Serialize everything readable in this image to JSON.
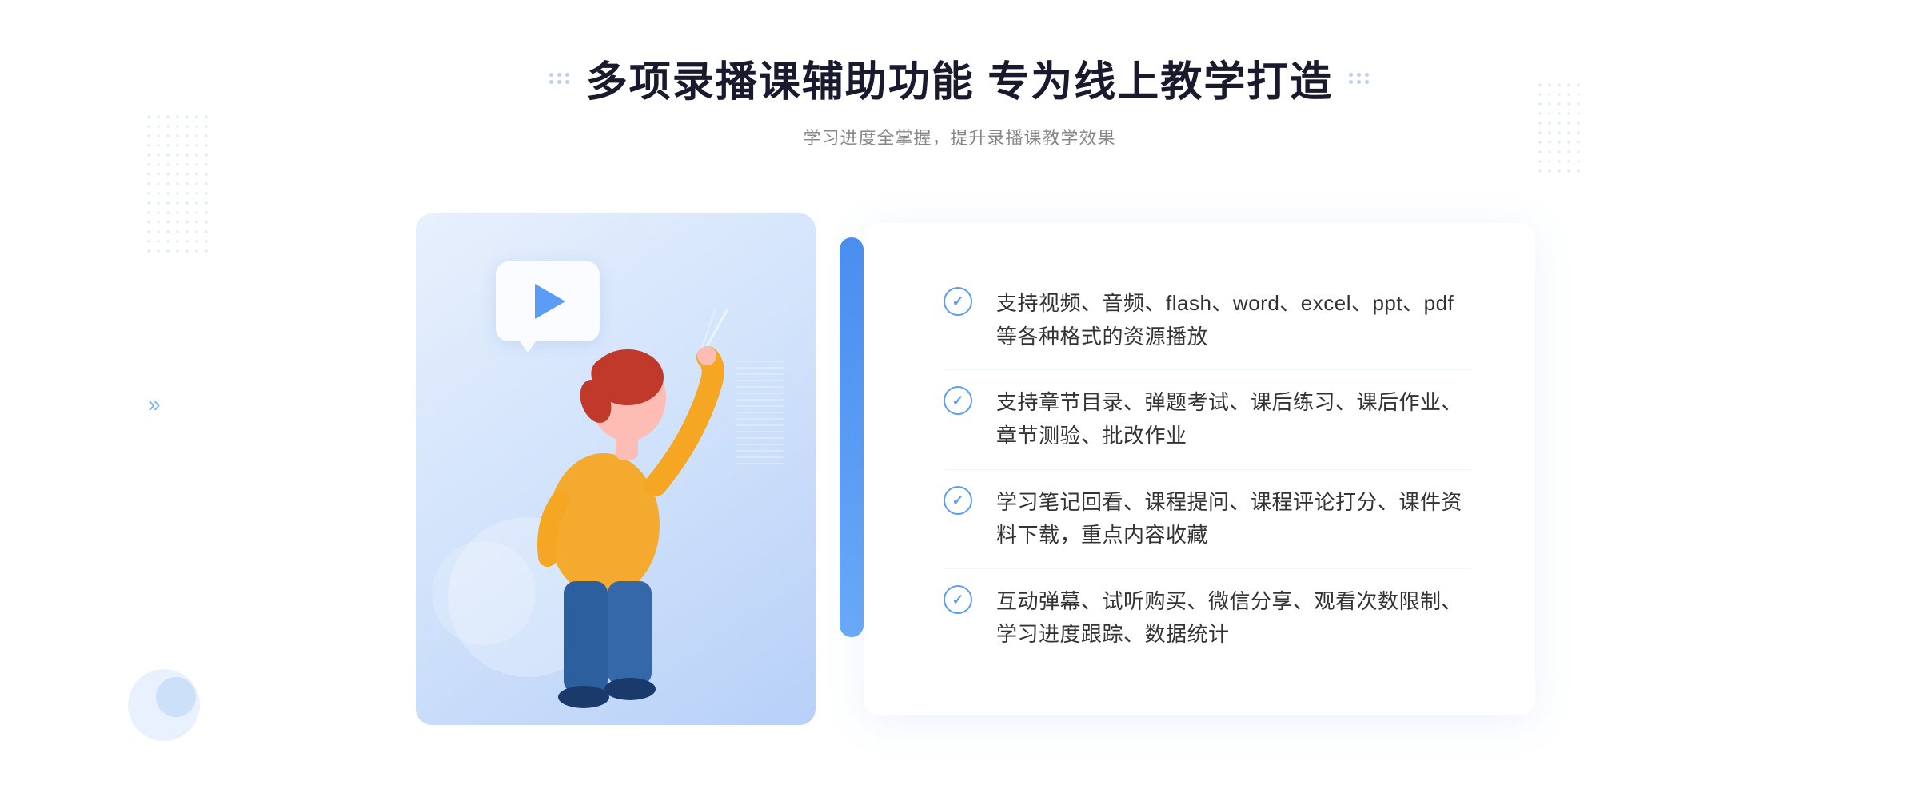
{
  "header": {
    "title": "多项录播课辅助功能 专为线上教学打造",
    "subtitle": "学习进度全掌握，提升录播课教学效果"
  },
  "features": [
    {
      "id": "feature-1",
      "text": "支持视频、音频、flash、word、excel、ppt、pdf等各种格式的资源播放"
    },
    {
      "id": "feature-2",
      "text": "支持章节目录、弹题考试、课后练习、课后作业、章节测验、批改作业"
    },
    {
      "id": "feature-3",
      "text": "学习笔记回看、课程提问、课程评论打分、课件资料下载，重点内容收藏"
    },
    {
      "id": "feature-4",
      "text": "互动弹幕、试听购买、微信分享、观看次数限制、学习进度跟踪、数据统计"
    }
  ],
  "decoration": {
    "chevron": "»",
    "play_button": "▶"
  }
}
